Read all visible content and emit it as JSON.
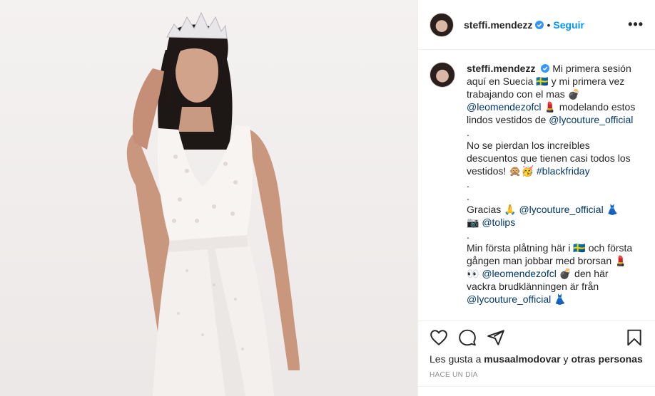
{
  "post": {
    "username": "steffi.mendezz",
    "follow_label": "Seguir",
    "separator": "•",
    "more_label": "•••",
    "caption": {
      "user": "steffi.mendezz",
      "l1": "Mi primera sesión",
      "l2": "aquí en Suecia 🇸🇪 y mi primera vez",
      "l3": "trabajando con el mas 💣",
      "l4_mention": "@leomendezofcl",
      "l4_rest": " 💄 modelando estos",
      "l5": "lindos vestidos de ",
      "l5_mention": "@lycouture_official",
      "l6": ".",
      "l7": "No se pierdan los increíbles",
      "l8": "descuentos que tienen casi todos los",
      "l9": "vestidos! 🙊🥳 ",
      "l9_tag": "#blackfriday",
      "l10": ".",
      "l11": ".",
      "l12": "Gracias 🙏 ",
      "l12_mention": "@lycouture_official",
      "l12_rest": " 👗",
      "l13": "📷 ",
      "l13_mention": "@tolips",
      "l14": ".",
      "l15": "Min första plåtning här i 🇸🇪 och första",
      "l16": "gången man jobbar med brorsan 💄",
      "l17": "👀 ",
      "l17_mention": "@leomendezofcl",
      "l17_rest": " 💣 den här",
      "l18": "vackra brudklänningen är från",
      "l19_mention": "@lycouture_official",
      "l19_rest": " 👗"
    },
    "likes_prefix": "Les gusta a ",
    "likes_user": "musaalmodovar",
    "likes_mid": " y ",
    "likes_others": "otras personas",
    "timestamp": "HACE UN DÍA"
  },
  "icons": {
    "verified": "verified-badge-icon",
    "like": "heart-icon",
    "comment": "comment-bubble-icon",
    "share": "paper-plane-icon",
    "save": "bookmark-icon",
    "more": "ellipsis-icon"
  },
  "colors": {
    "link": "#0095f6",
    "mention": "#00376b",
    "muted": "#8e8e8e",
    "text": "#262626"
  }
}
